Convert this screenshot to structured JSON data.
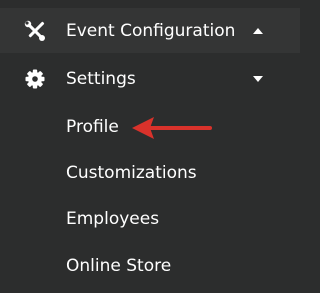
{
  "menu": {
    "event_configuration": {
      "label": "Event Configuration",
      "icon": "tools-icon",
      "caret": "caret-up-icon"
    },
    "settings": {
      "label": "Settings",
      "icon": "gear-icon",
      "caret": "caret-down-icon",
      "items": [
        {
          "label": "Profile"
        },
        {
          "label": "Customizations"
        },
        {
          "label": "Employees"
        },
        {
          "label": "Online Store"
        }
      ]
    }
  },
  "annotation": {
    "icon": "red-arrow-icon",
    "color": "#d9322b"
  },
  "colors": {
    "background": "#2c2d2d",
    "header_row": "#343535",
    "text": "#ffffff"
  }
}
